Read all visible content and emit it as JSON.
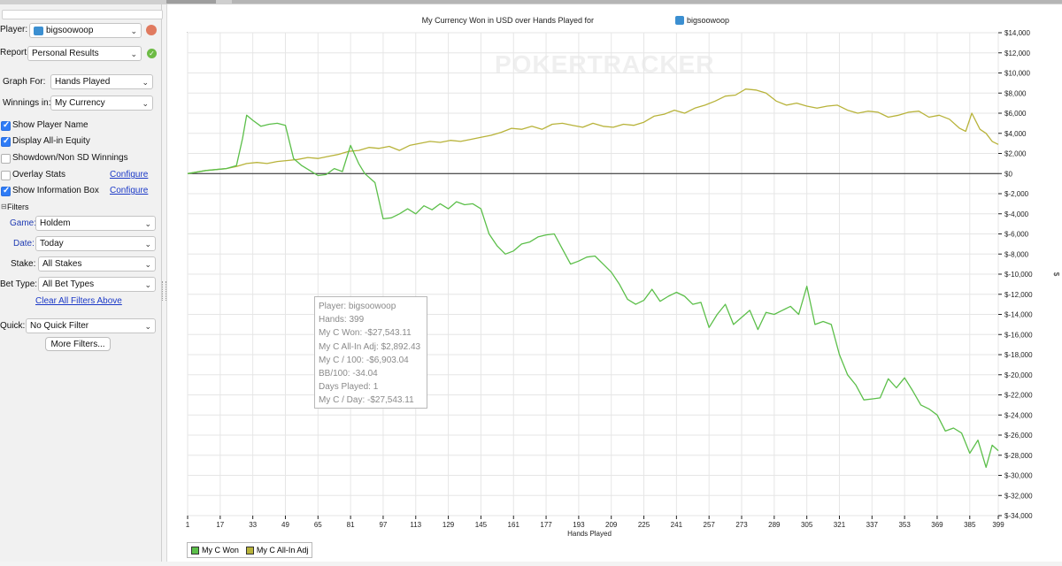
{
  "sidebar": {
    "player_label": "Player:",
    "player_value": "bigsoowoop",
    "report_label": "Report:",
    "report_value": "Personal Results",
    "graph_for_label": "Graph For:",
    "graph_for_value": "Hands Played",
    "winnings_in_label": "Winnings in:",
    "winnings_in_value": "My Currency",
    "options": [
      {
        "label": "Show Player Name",
        "checked": true
      },
      {
        "label": "Display All-in Equity",
        "checked": true
      },
      {
        "label": "Showdown/Non SD Winnings",
        "checked": false
      },
      {
        "label": "Overlay Stats",
        "checked": false,
        "link": "Configure"
      },
      {
        "label": "Show Information Box",
        "checked": true,
        "link": "Configure"
      }
    ],
    "filters_header": "Filters",
    "game_label": "Game:",
    "game_value": "Holdem",
    "date_label": "Date:",
    "date_value": "Today",
    "stake_label": "Stake:",
    "stake_value": "All Stakes",
    "bet_type_label": "Bet Type:",
    "bet_type_value": "All Bet Types",
    "clear_filters": "Clear All Filters Above",
    "quick_label": "Quick:",
    "quick_value": "No Quick Filter",
    "more_filters": "More Filters..."
  },
  "chart": {
    "title": "My Currency Won in USD over Hands Played for",
    "title_player": "bigsoowoop",
    "watermark": "POKERTRACKER",
    "colors": {
      "won": "#5cbf4a",
      "allin": "#b8b33a"
    }
  },
  "info_box": [
    "Player: bigsoowoop",
    "Hands: 399",
    "My C Won: -$27,543.11",
    "My C All-In Adj: $2,892.43",
    "My C / 100: -$6,903.04",
    "BB/100: -34.04",
    "Days Played: 1",
    "My C / Day: -$27,543.11"
  ],
  "chart_data": {
    "type": "line",
    "title": "My Currency Won in USD over Hands Played for bigsoowoop",
    "xlabel": "Hands Played",
    "ylabel": "$",
    "xlim": [
      1,
      399
    ],
    "ylim": [
      -34000,
      14000
    ],
    "x_ticks": [
      1,
      17,
      33,
      49,
      65,
      81,
      97,
      113,
      129,
      145,
      161,
      177,
      193,
      209,
      225,
      241,
      257,
      273,
      289,
      305,
      321,
      337,
      353,
      369,
      385,
      399
    ],
    "y_ticks": [
      14000,
      12000,
      10000,
      8000,
      6000,
      4000,
      2000,
      0,
      -2000,
      -4000,
      -6000,
      -8000,
      -10000,
      -12000,
      -14000,
      -16000,
      -18000,
      -20000,
      -22000,
      -24000,
      -26000,
      -28000,
      -30000,
      -32000,
      -34000
    ],
    "y_tick_labels": [
      "$14,000",
      "$12,000",
      "$10,000",
      "$8,000",
      "$6,000",
      "$4,000",
      "$2,000",
      "$0",
      "$-2,000",
      "$-4,000",
      "$-6,000",
      "$-8,000",
      "$-10,000",
      "$-12,000",
      "$-14,000",
      "$-16,000",
      "$-18,000",
      "$-20,000",
      "$-22,000",
      "$-24,000",
      "$-26,000",
      "$-28,000",
      "$-30,000",
      "$-32,000",
      "$-34,000"
    ],
    "grid": true,
    "legend": "bottom-left",
    "series": [
      {
        "name": "My C Won",
        "x": [
          1,
          10,
          20,
          25,
          28,
          30,
          33,
          37,
          41,
          45,
          49,
          53,
          57,
          61,
          65,
          69,
          73,
          77,
          81,
          85,
          88,
          93,
          97,
          101,
          105,
          109,
          113,
          117,
          121,
          125,
          129,
          133,
          137,
          141,
          145,
          149,
          153,
          157,
          161,
          165,
          169,
          173,
          177,
          181,
          185,
          189,
          193,
          197,
          201,
          205,
          209,
          213,
          217,
          221,
          225,
          229,
          233,
          237,
          241,
          245,
          249,
          253,
          257,
          261,
          265,
          269,
          273,
          277,
          281,
          285,
          289,
          293,
          297,
          301,
          305,
          309,
          313,
          317,
          321,
          325,
          329,
          333,
          337,
          341,
          345,
          349,
          353,
          357,
          361,
          365,
          369,
          373,
          377,
          381,
          385,
          389,
          393,
          396,
          399
        ],
        "y": [
          0,
          300,
          500,
          800,
          3500,
          5800,
          5300,
          4700,
          4900,
          5000,
          4800,
          1500,
          800,
          300,
          -200,
          -100,
          500,
          200,
          2800,
          1000,
          0,
          -900,
          -4500,
          -4400,
          -4000,
          -3500,
          -4000,
          -3200,
          -3600,
          -3000,
          -3500,
          -2800,
          -3100,
          -3000,
          -3500,
          -6000,
          -7200,
          -8000,
          -7700,
          -7000,
          -6800,
          -6300,
          -6100,
          -6000,
          -7500,
          -9000,
          -8700,
          -8300,
          -8200,
          -9000,
          -9800,
          -11000,
          -12500,
          -13000,
          -12600,
          -11500,
          -12700,
          -12200,
          -11800,
          -12200,
          -13000,
          -12800,
          -15300,
          -14000,
          -13000,
          -15000,
          -14300,
          -13600,
          -15500,
          -13800,
          -14000,
          -13600,
          -13200,
          -14000,
          -11200,
          -15000,
          -14700,
          -15000,
          -18000,
          -20000,
          -21000,
          -22500,
          -22400,
          -22300,
          -20400,
          -21300,
          -20300,
          -21600,
          -23000,
          -23400,
          -24000,
          -25600,
          -25300,
          -25800,
          -27800,
          -26500,
          -29200,
          -27000,
          -27543.11
        ]
      },
      {
        "name": "My C All-In Adj",
        "x": [
          1,
          10,
          20,
          25,
          30,
          35,
          40,
          45,
          50,
          55,
          60,
          65,
          70,
          75,
          80,
          85,
          90,
          95,
          100,
          105,
          110,
          115,
          120,
          125,
          130,
          135,
          140,
          145,
          150,
          155,
          160,
          165,
          170,
          175,
          180,
          185,
          190,
          195,
          200,
          205,
          210,
          215,
          220,
          225,
          230,
          235,
          240,
          245,
          250,
          255,
          260,
          265,
          270,
          275,
          280,
          285,
          290,
          295,
          300,
          305,
          310,
          315,
          320,
          325,
          330,
          335,
          340,
          345,
          350,
          355,
          360,
          365,
          370,
          375,
          380,
          383,
          386,
          390,
          393,
          396,
          399
        ],
        "y": [
          0,
          300,
          500,
          700,
          1000,
          1100,
          1000,
          1200,
          1300,
          1400,
          1600,
          1500,
          1700,
          1900,
          2200,
          2300,
          2600,
          2500,
          2700,
          2300,
          2800,
          3000,
          3200,
          3100,
          3300,
          3200,
          3400,
          3600,
          3800,
          4100,
          4500,
          4400,
          4700,
          4400,
          4900,
          5000,
          4800,
          4600,
          5000,
          4700,
          4600,
          4900,
          4800,
          5100,
          5700,
          5900,
          6300,
          6000,
          6500,
          6800,
          7200,
          7700,
          7800,
          8400,
          8300,
          8000,
          7200,
          6800,
          7000,
          6700,
          6500,
          6700,
          6800,
          6300,
          6000,
          6200,
          6100,
          5600,
          5800,
          6100,
          6200,
          5600,
          5800,
          5400,
          4500,
          4200,
          6000,
          4400,
          4000,
          3200,
          2892.43
        ]
      }
    ]
  }
}
